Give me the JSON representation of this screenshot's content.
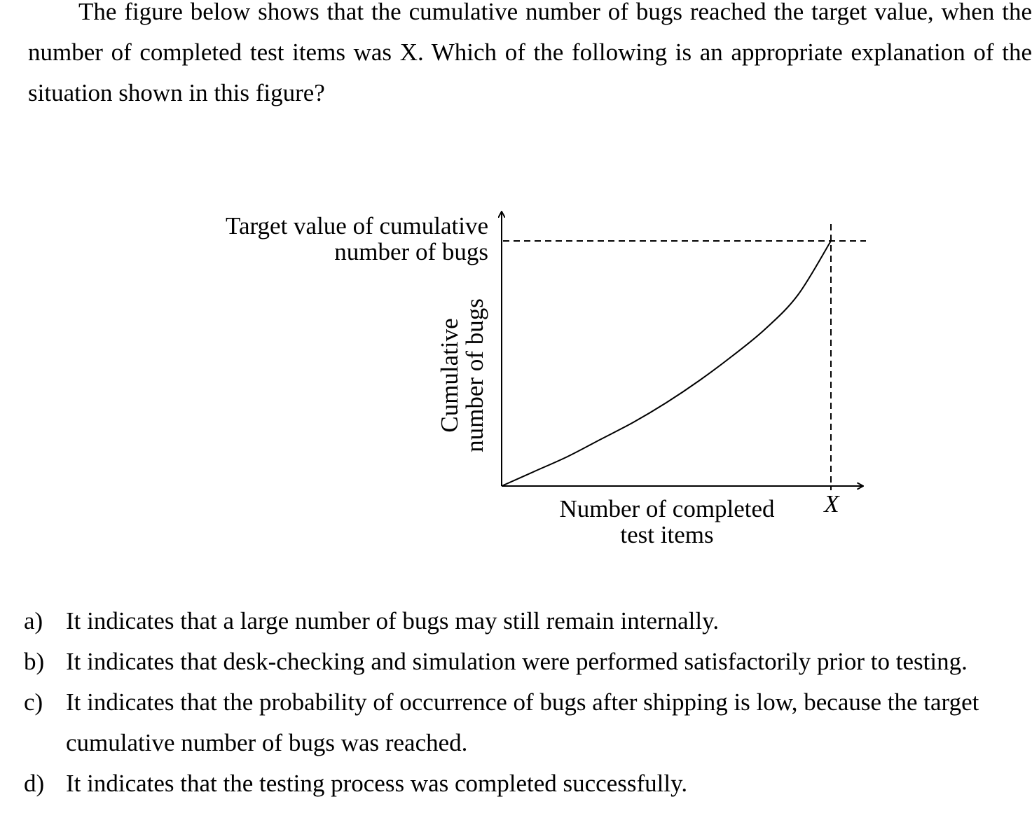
{
  "question": {
    "text": "The figure below shows that the cumulative number of bugs reached the target value, when the number of completed test items was X. Which of the following is an appropriate explanation of the situation shown in this figure?"
  },
  "figure": {
    "target_label_line1": "Target value of cumulative",
    "target_label_line2": "number of bugs",
    "ylabel_line1": "Cumulative",
    "ylabel_line2": "number of bugs",
    "xlabel_line1": "Number of completed",
    "xlabel_line2": "test items",
    "x_marker": "X"
  },
  "chart_data": {
    "type": "line",
    "xlabel": "Number of completed test items",
    "ylabel": "Cumulative number of bugs",
    "series": [
      {
        "x": [
          0,
          0.1,
          0.2,
          0.3,
          0.4,
          0.5,
          0.6,
          0.7,
          0.8,
          0.9,
          1.0
        ],
        "y": [
          0,
          0.06,
          0.12,
          0.19,
          0.26,
          0.34,
          0.43,
          0.53,
          0.64,
          0.78,
          1.0
        ]
      }
    ],
    "annotations": [
      "Target value of cumulative number of bugs",
      "X"
    ],
    "curve_shape": "convex, increasing",
    "grid": false
  },
  "options": [
    {
      "letter": "a)",
      "text": "It indicates that a large number of bugs may still remain internally."
    },
    {
      "letter": "b)",
      "text": "It indicates that desk-checking and simulation were performed satisfactorily prior to testing."
    },
    {
      "letter": "c)",
      "text": "It indicates that the probability of occurrence of bugs after shipping is low, because the target cumulative number of bugs was reached."
    },
    {
      "letter": "d)",
      "text": "It indicates that the testing process was completed successfully."
    }
  ]
}
